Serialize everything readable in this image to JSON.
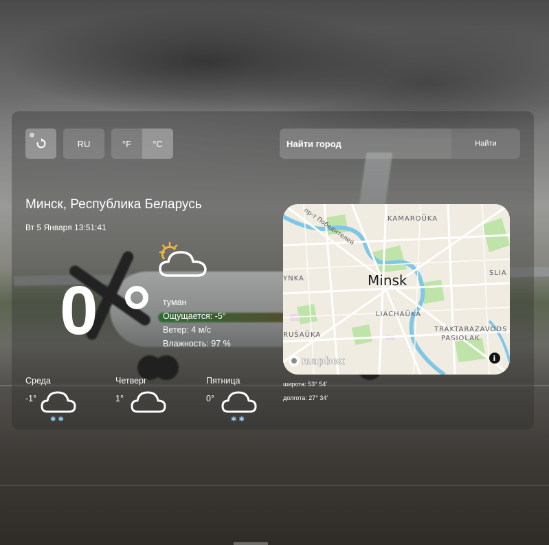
{
  "toolbar": {
    "lang_label": "RU",
    "unit_f": "°F",
    "unit_c": "°C",
    "active_unit": "C"
  },
  "search": {
    "placeholder": "Найти город",
    "button_label": "Найти"
  },
  "current": {
    "location": "Минск, Республика Беларусь",
    "datetime": "Вт 5 Января 13:51:41",
    "temperature": "0",
    "condition": "туман",
    "feels_like": "Ощущается: -5°",
    "wind": "Ветер: 4 м/с",
    "humidity": "Влажность: 97 %",
    "icon": "partly-cloudy-day-icon"
  },
  "forecast": [
    {
      "day": "Среда",
      "temp": "-1°",
      "icon": "snow-cloud-icon"
    },
    {
      "day": "Четверг",
      "temp": "1°",
      "icon": "cloud-icon"
    },
    {
      "day": "Пятница",
      "temp": "0°",
      "icon": "snow-cloud-icon"
    }
  ],
  "map": {
    "city_label": "Minsk",
    "districts": [
      "KAMAROŬKA",
      "SLIA",
      "YNKA",
      "LIACHAŬKA",
      "RUŠAŬKA",
      "TRAKTARAZAVODS",
      "PASIOLAK"
    ],
    "street_label": "пр-т Победителей",
    "attribution": "mapbox",
    "info_symbol": "i"
  },
  "coordinates": {
    "latitude": "широта: 53° 54'",
    "longitude": "долгота: 27° 34'"
  },
  "colors": {
    "panel": "rgba(40,40,40,0.32)",
    "button": "rgba(170,170,170,0.35)",
    "map_road": "#ffffff",
    "map_park": "#b9e3a8",
    "map_water": "#7cc6e6"
  }
}
